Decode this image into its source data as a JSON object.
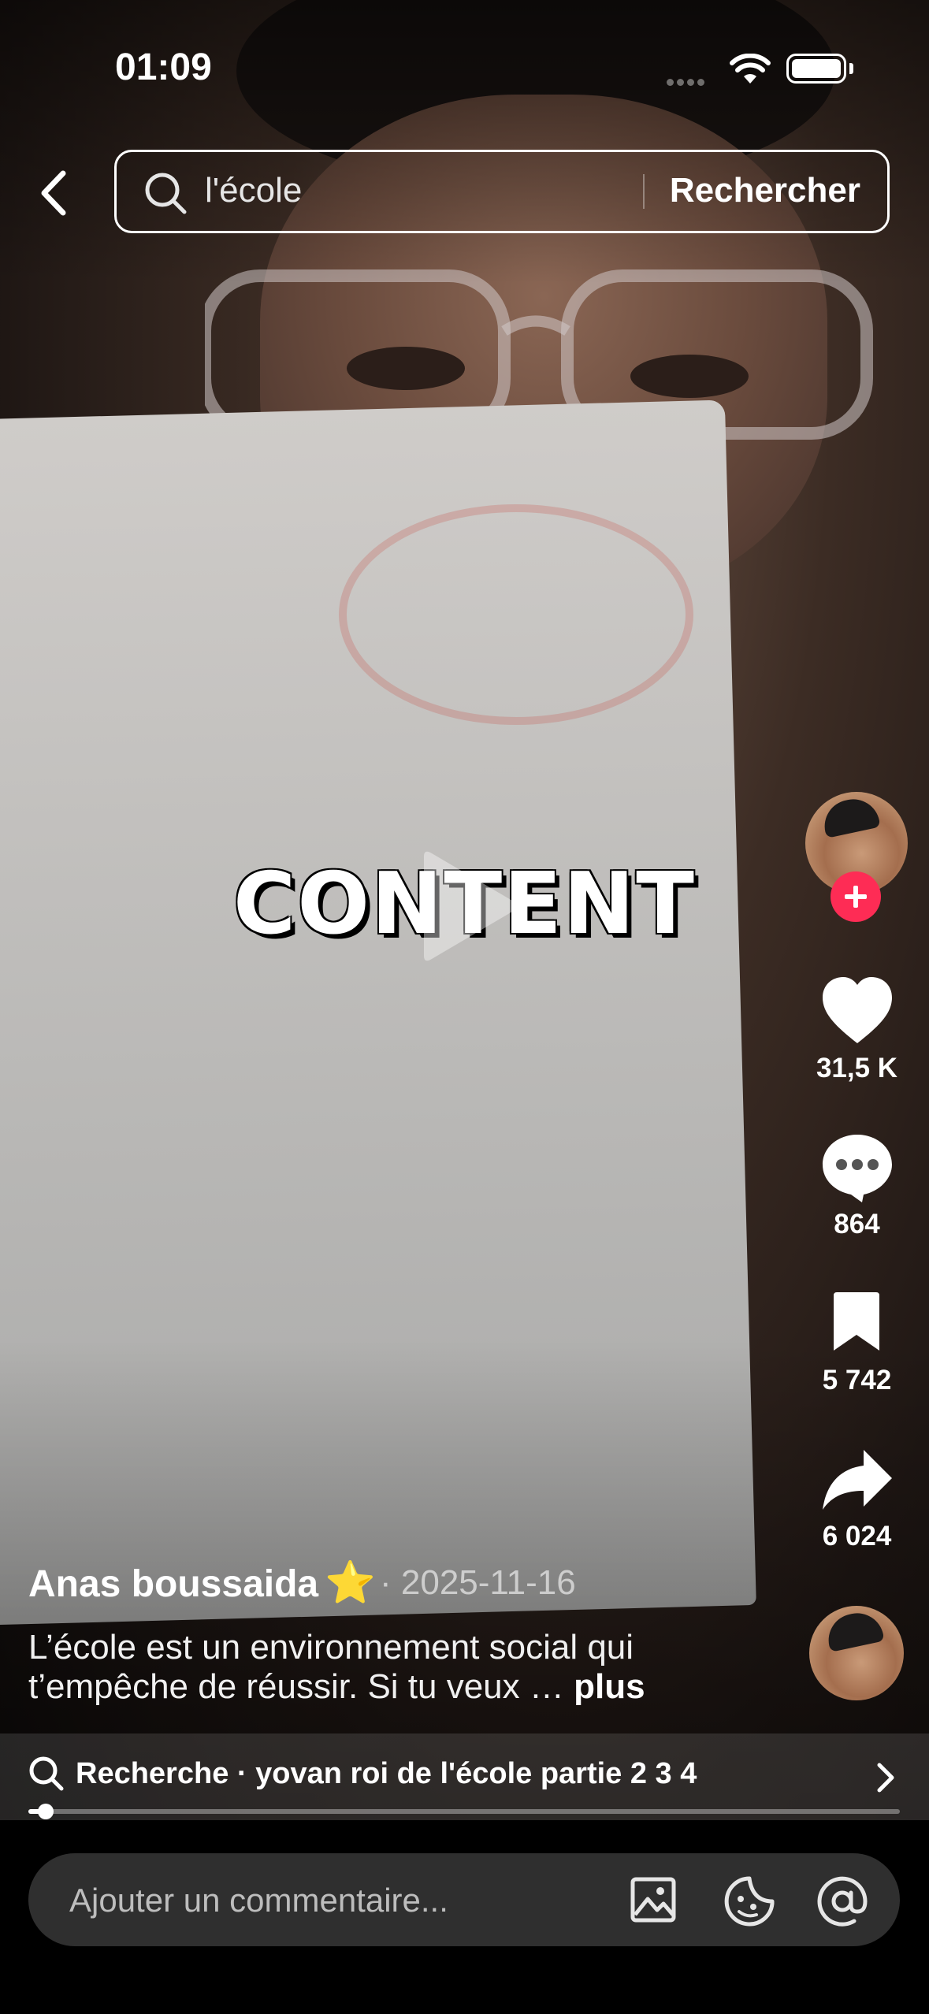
{
  "status_bar": {
    "time": "01:09"
  },
  "search": {
    "query": "l'école",
    "button": "Rechercher"
  },
  "video": {
    "overlay_text": "CONTENT"
  },
  "actions": {
    "likes": "31,5 K",
    "comments": "864",
    "bookmarks": "5 742",
    "shares": "6 024"
  },
  "post": {
    "author": "Anas boussaida",
    "author_emoji": "⭐",
    "date": "· 2025-11-16",
    "caption": "L’école est un environnement social qui t’empêche de réussir. Si tu veux … ",
    "more": "plus"
  },
  "related_search": {
    "text": "Recherche · yovan roi de l'école partie 2 3 4"
  },
  "playback": {
    "progress_fraction": 0.02
  },
  "comment": {
    "placeholder": "Ajouter un commentaire..."
  },
  "colors": {
    "accent": "#fe2c55",
    "background": "#000000"
  }
}
